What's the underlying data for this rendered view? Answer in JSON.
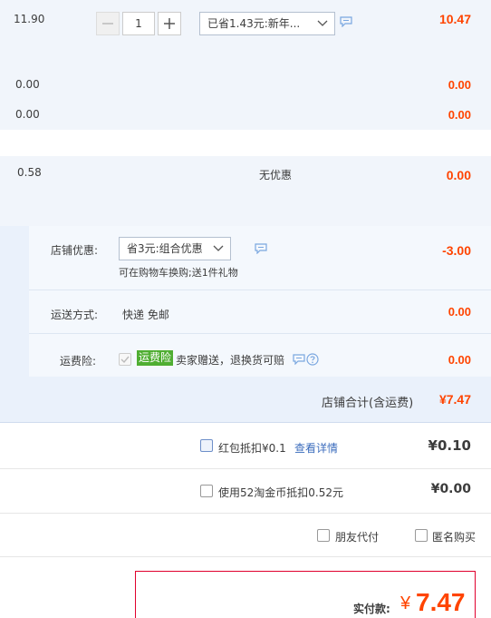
{
  "item": {
    "unit_price": "11.90",
    "quantity": "1",
    "discount_select": "已省1.43元:新年...",
    "subtotal": "10.47"
  },
  "fee_rows": [
    {
      "left": "0.00",
      "right": "0.00"
    },
    {
      "left": "0.00",
      "right": "0.00"
    }
  ],
  "service_row": {
    "left": "0.58",
    "middle": "无优惠",
    "right": "0.00"
  },
  "shop_discount": {
    "label": "店铺优惠:",
    "select": "省3元:组合优惠",
    "note": "可在购物车换购;送1件礼物",
    "amount": "-3.00"
  },
  "shipping": {
    "label": "运送方式:",
    "value": "快递 免邮",
    "amount": "0.00"
  },
  "insurance": {
    "label": "运费险:",
    "tag": "运费险",
    "text": "卖家赠送，退换货可赔",
    "amount": "0.00"
  },
  "shop_total": {
    "label": "店铺合计(含运费)",
    "amount": "¥7.47"
  },
  "red_packet": {
    "label": "红包抵扣¥0.1",
    "link": "查看详情",
    "amount": "¥0.10"
  },
  "taojinbi": {
    "label": "使用52淘金币抵扣0.52元",
    "amount": "¥0.00"
  },
  "options": {
    "friend_pay": "朋友代付",
    "anonymous": "匿名购买"
  },
  "payment": {
    "label": "实付款:",
    "currency": "¥",
    "amount": "7.47"
  },
  "colors": {
    "accent": "#ff4400",
    "pay_border": "#e0002d",
    "blue_band": "#eaf1fb",
    "green_tag": "#4fae32",
    "link": "#3c6dbd"
  },
  "icons": [
    "minus-icon",
    "plus-icon",
    "chevron-down-icon",
    "message-icon",
    "checkmark-icon",
    "help-icon"
  ]
}
